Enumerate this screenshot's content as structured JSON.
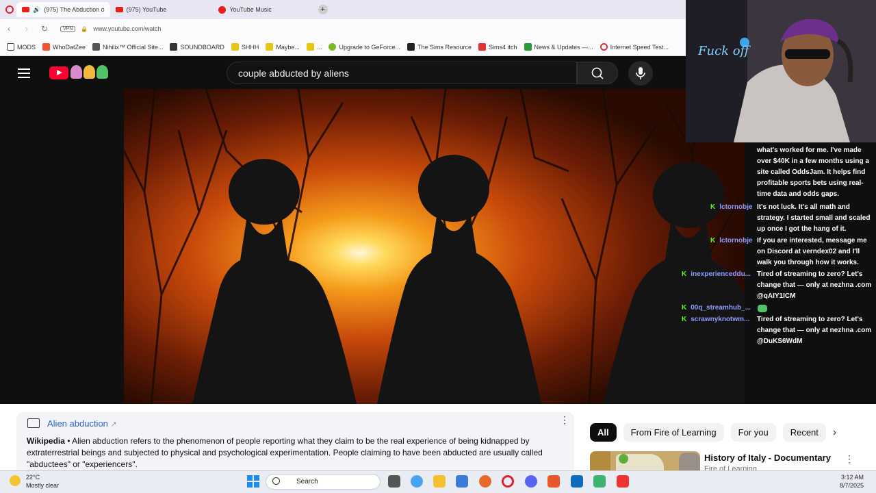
{
  "browser": {
    "tabs": [
      {
        "title": "(975) The Abduction o",
        "active": true
      },
      {
        "title": "(975) YouTube",
        "active": false
      },
      {
        "title": "YouTube Music",
        "active": false
      }
    ],
    "new_tab_label": "+",
    "url": "www.youtube.com/watch",
    "vpn_label": "VPN",
    "bookmarks": [
      "MODS",
      "WhoDatZee",
      "Nihilix™ Official Site...",
      "SOUNDBOARD",
      "SHHH",
      "Maybe...",
      "...",
      "Upgrade to GeForce...",
      "The Sims Resource",
      "Sims4 itch",
      "News & Updates —...",
      "Internet Speed Test..."
    ]
  },
  "youtube": {
    "search_query": "couple abducted by aliens"
  },
  "webcam": {
    "overlay_text": "Fuck off"
  },
  "chat": {
    "lines": [
      {
        "user": "",
        "text": "what's worked for me. I've made over $40K in a few months using a site called OddsJam. It helps find profitable sports bets using real-time data and odds gaps."
      },
      {
        "user": "lctornobje",
        "text": "It's not luck. It's all math and strategy. I started small and scaled up once I got the hang of it."
      },
      {
        "user": "lctornobje",
        "text": "If you are interested, message me on Discord at verndex02 and I'll walk you through how it works."
      },
      {
        "user": "inexperienceddu...",
        "text": "Tired of streaming to zero? Let's change that — only at nezhna .com @qAIY1ICM"
      },
      {
        "user": "00q_streamhub_...",
        "text": ""
      },
      {
        "user": "scrawnyknotwm...",
        "text": "Tired of streaming to zero? Let's change that — only at nezhna .com @DuKS6WdM"
      }
    ],
    "kick_badge": "K"
  },
  "info_card": {
    "title": "Alien abduction",
    "source": "Wikipedia",
    "body": " • Alien abduction refers to the phenomenon of people reporting what they claim to be the real experience of being kidnapped by extraterrestrial beings and subjected to physical and psychological experimentation. People claiming to have been abducted are usually called \"abductees\" or \"experiencers\"."
  },
  "chips": [
    "All",
    "From Fire of Learning",
    "For you",
    "Recent"
  ],
  "recommendation": {
    "title": "History of Italy - Documentary",
    "channel": "Fire of Learning"
  },
  "taskbar": {
    "temperature": "22°C",
    "weather": "Mostly clear",
    "search_label": "Search",
    "time": "3:12 AM",
    "date": "8/7/2025"
  }
}
